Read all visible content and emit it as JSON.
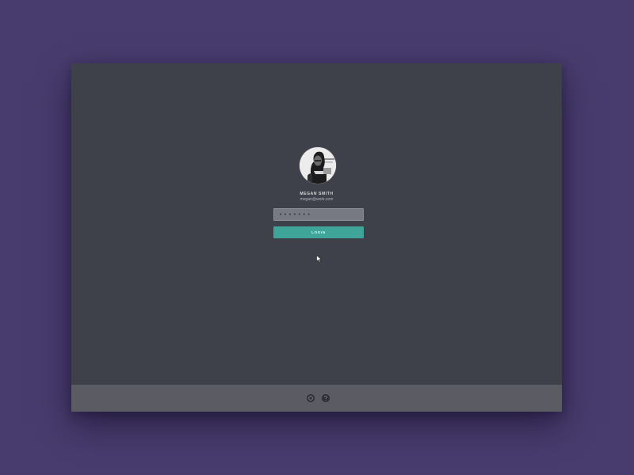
{
  "user": {
    "name": "MEGAN SMITH",
    "email": "megan@work.com",
    "avatar_icon": "user-avatar-photo"
  },
  "password_field": {
    "value": "•••••••"
  },
  "login_button": {
    "label": "LOGIN"
  },
  "footer": {
    "settings_icon": "gear-icon",
    "help_icon": "help-icon"
  },
  "colors": {
    "background": "#483c6e",
    "panel": "#3e4149",
    "footer": "#5a5b63",
    "accent": "#3fa598",
    "input": "#777a82"
  }
}
